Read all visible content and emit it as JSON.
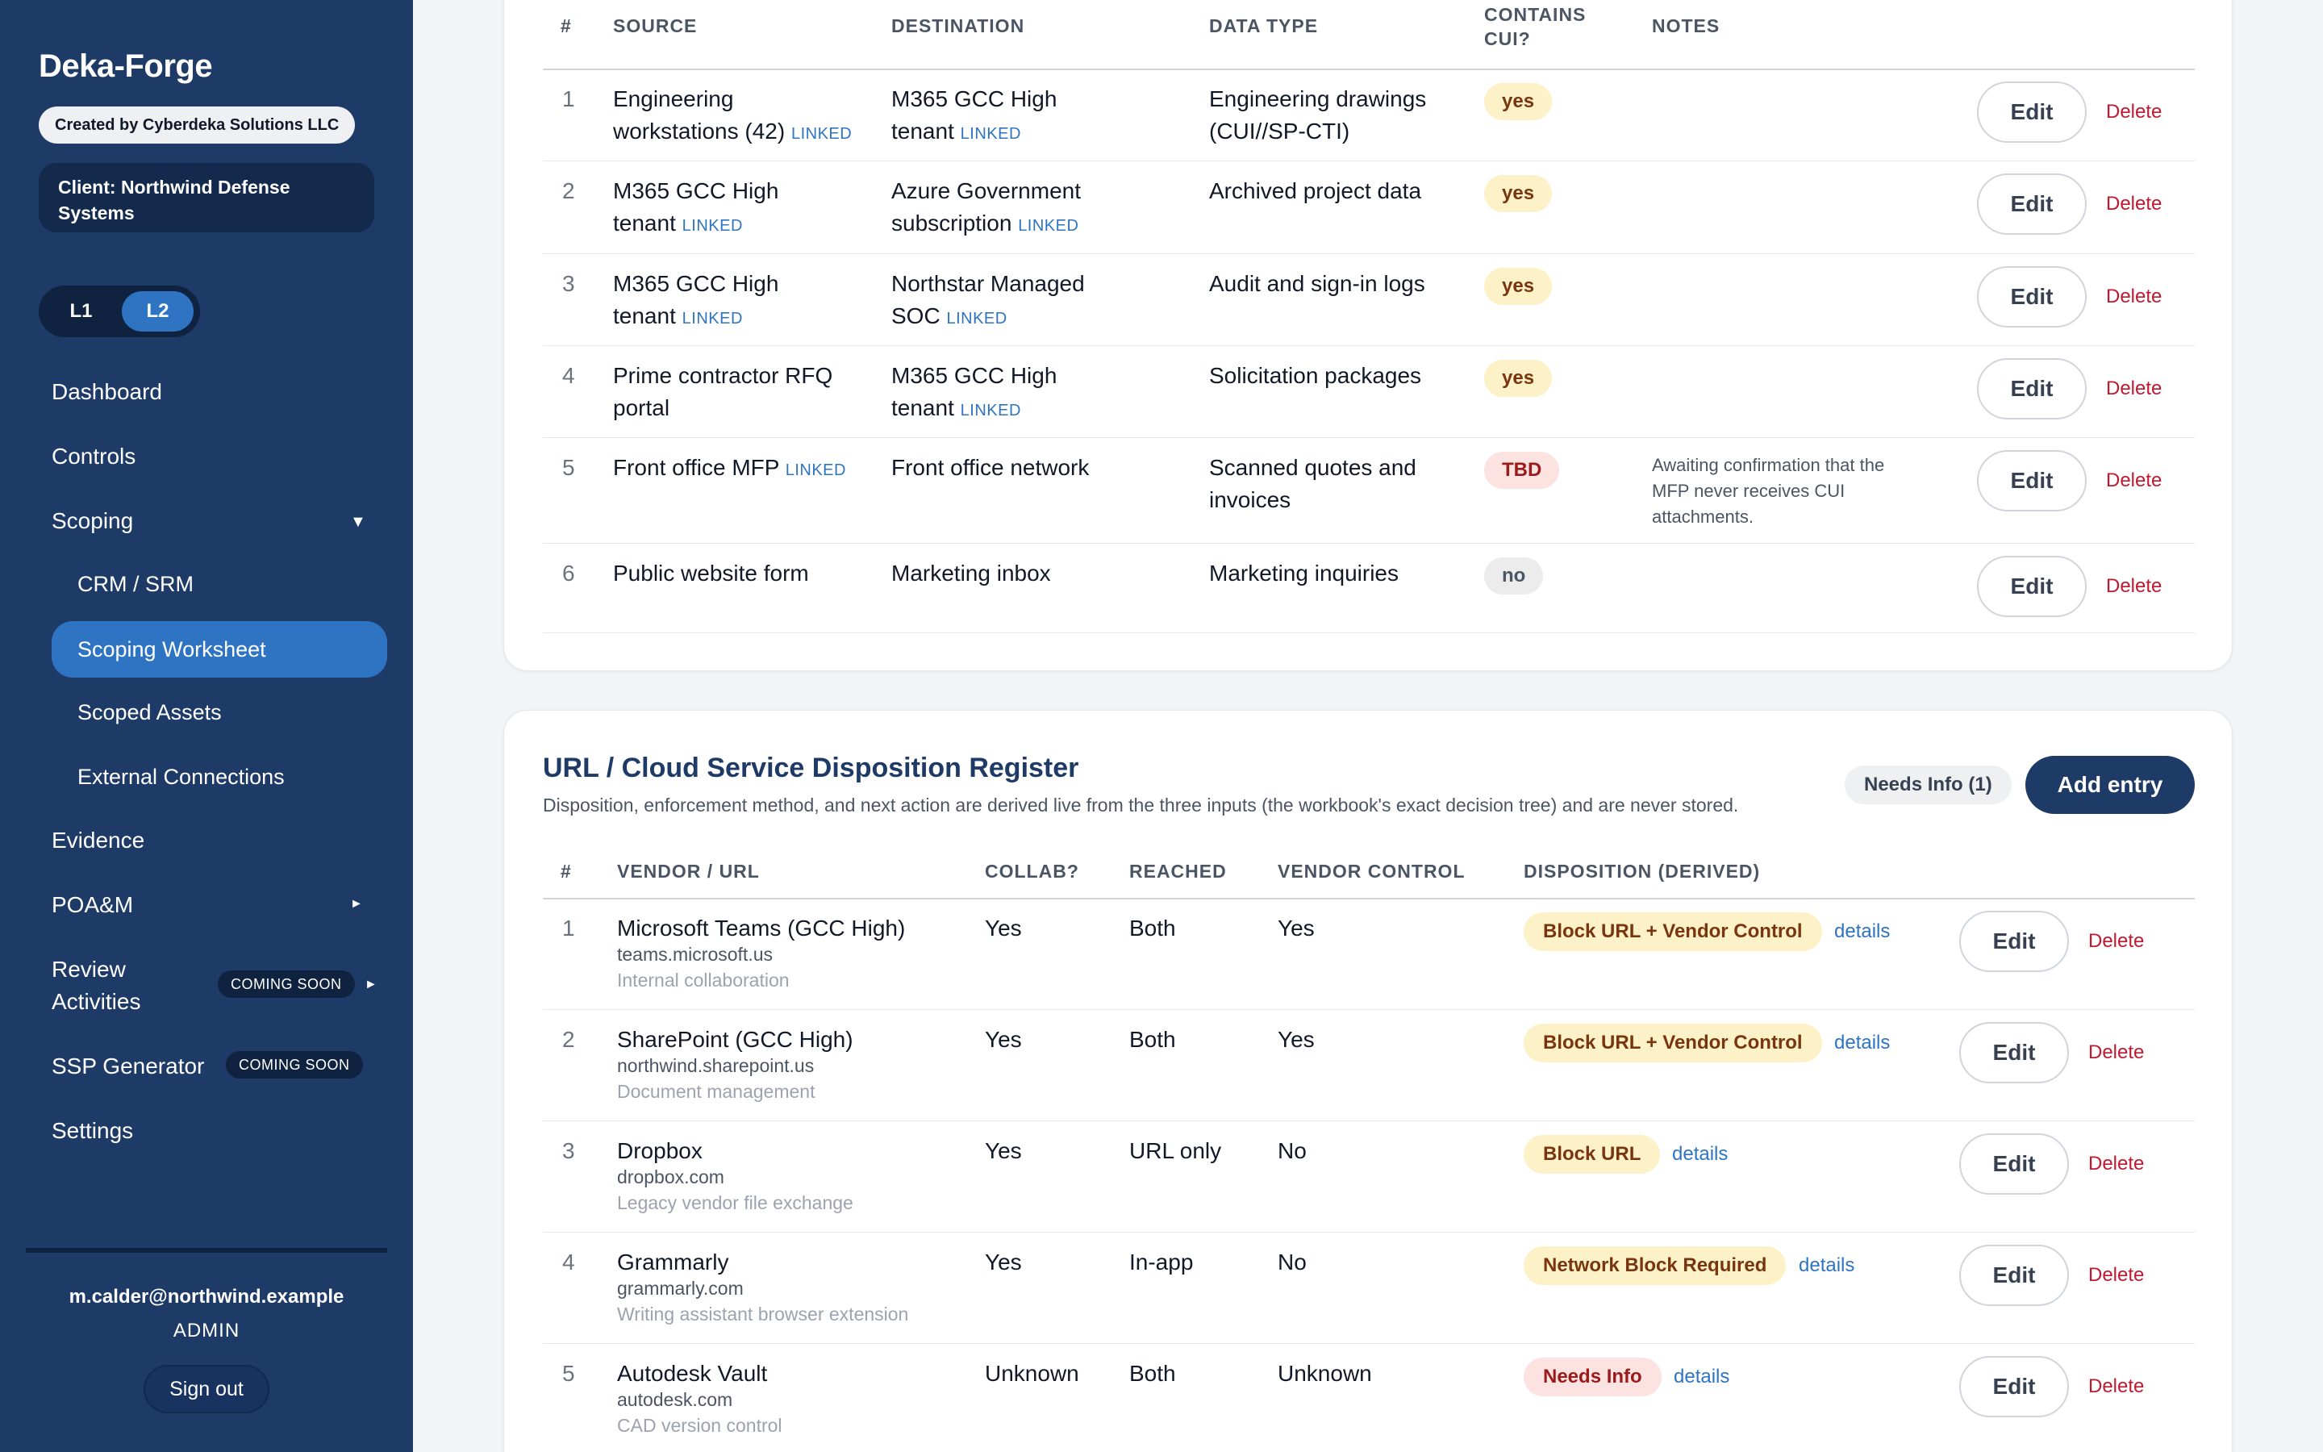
{
  "app": {
    "brand": "Deka-Forge",
    "creator": "Created by Cyberdeka Solutions LLC",
    "client": "Client: Northwind Defense Systems",
    "levels": [
      "L1",
      "L2"
    ],
    "active_level": "L2"
  },
  "nav": {
    "dashboard": "Dashboard",
    "controls": "Controls",
    "scoping": "Scoping",
    "crm_srm": "CRM / SRM",
    "scoping_worksheet": "Scoping Worksheet",
    "scoped_assets": "Scoped Assets",
    "external_connections": "External Connections",
    "evidence": "Evidence",
    "poam": "POA&M",
    "review_line1": "Review",
    "review_line2": "Activities",
    "ssp_generator": "SSP Generator",
    "settings": "Settings",
    "coming_soon": "COMING SOON",
    "caret_down": "▼",
    "caret_right": "►"
  },
  "user": {
    "email": "m.calder@northwind.example",
    "role": "ADMIN",
    "signout": "Sign out"
  },
  "flows": {
    "headers": {
      "num": "#",
      "source": "SOURCE",
      "destination": "DESTINATION",
      "data_type": "DATA TYPE",
      "cui_line1": "CONTAINS",
      "cui_line2": "CUI?",
      "notes": "NOTES"
    },
    "linked": "LINKED",
    "edit": "Edit",
    "delete": "Delete",
    "rows": [
      {
        "num": "1",
        "src1": "Engineering",
        "src2": "workstations (42)",
        "dst1": "M365 GCC High",
        "dst2": "tenant",
        "type1": "Engineering drawings",
        "type2": "(CUI//SP-CTI)",
        "cui": "yes",
        "note1": "",
        "note2": "",
        "note3": ""
      },
      {
        "num": "2",
        "src1": "M365 GCC High",
        "src2": "tenant",
        "dst1": "Azure Government",
        "dst2": "subscription",
        "type1": "Archived project data",
        "type2": "",
        "cui": "yes",
        "note1": "",
        "note2": "",
        "note3": ""
      },
      {
        "num": "3",
        "src1": "M365 GCC High",
        "src2": "tenant",
        "dst1": "Northstar Managed",
        "dst2": "SOC",
        "type1": "Audit and sign-in logs",
        "type2": "",
        "cui": "yes",
        "note1": "",
        "note2": "",
        "note3": ""
      },
      {
        "num": "4",
        "src1": "Prime contractor RFQ",
        "src2": "portal",
        "dst1": "M365 GCC High",
        "dst2": "tenant",
        "type1": "Solicitation packages",
        "type2": "",
        "cui": "yes",
        "note1": "",
        "note2": "",
        "note3": ""
      },
      {
        "num": "5",
        "src1": "Front office MFP",
        "src2": "",
        "dst1": "Front office network",
        "dst2": "",
        "type1": "Scanned quotes and",
        "type2": "invoices",
        "cui": "TBD",
        "note1": "Awaiting confirmation that the",
        "note2": "MFP never receives CUI",
        "note3": "attachments."
      },
      {
        "num": "6",
        "src1": "Public website form",
        "src2": "",
        "dst1": "Marketing inbox",
        "dst2": "",
        "type1": "Marketing inquiries",
        "type2": "",
        "cui": "no",
        "note1": "",
        "note2": "",
        "note3": ""
      }
    ]
  },
  "register": {
    "title": "URL / Cloud Service Disposition Register",
    "subtitle": "Disposition, enforcement method, and next action are derived live from the three inputs (the workbook's exact decision tree) and are never stored.",
    "needs_info": "Needs Info (1)",
    "add_entry": "Add entry",
    "headers": {
      "num": "#",
      "vendor": "VENDOR / URL",
      "collab": "COLLAB?",
      "reached": "REACHED",
      "vendor_control": "VENDOR CONTROL",
      "disposition": "DISPOSITION (DERIVED)"
    },
    "details": "details",
    "edit": "Edit",
    "delete": "Delete",
    "rows": [
      {
        "num": "1",
        "name": "Microsoft Teams (GCC High)",
        "url": "teams.microsoft.us",
        "desc": "Internal collaboration",
        "collab": "Yes",
        "reached": "Both",
        "vendor_control": "Yes",
        "disposition": "Block URL + Vendor Control"
      },
      {
        "num": "2",
        "name": "SharePoint (GCC High)",
        "url": "northwind.sharepoint.us",
        "desc": "Document management",
        "collab": "Yes",
        "reached": "Both",
        "vendor_control": "Yes",
        "disposition": "Block URL + Vendor Control"
      },
      {
        "num": "3",
        "name": "Dropbox",
        "url": "dropbox.com",
        "desc": "Legacy vendor file exchange",
        "collab": "Yes",
        "reached": "URL only",
        "vendor_control": "No",
        "disposition": "Block URL"
      },
      {
        "num": "4",
        "name": "Grammarly",
        "url": "grammarly.com",
        "desc": "Writing assistant browser extension",
        "collab": "Yes",
        "reached": "In-app",
        "vendor_control": "No",
        "disposition": "Network Block Required"
      },
      {
        "num": "5",
        "name": "Autodesk Vault",
        "url": "autodesk.com",
        "desc": "CAD version control",
        "collab": "Unknown",
        "reached": "Both",
        "vendor_control": "Unknown",
        "disposition": "Needs Info"
      }
    ]
  },
  "colors": {
    "sidebar": "#1e3a66",
    "accent": "#2e74c3",
    "yellow_badge": "#fdf1c7",
    "red_badge": "#fde2e2",
    "delete": "#c0182f"
  }
}
